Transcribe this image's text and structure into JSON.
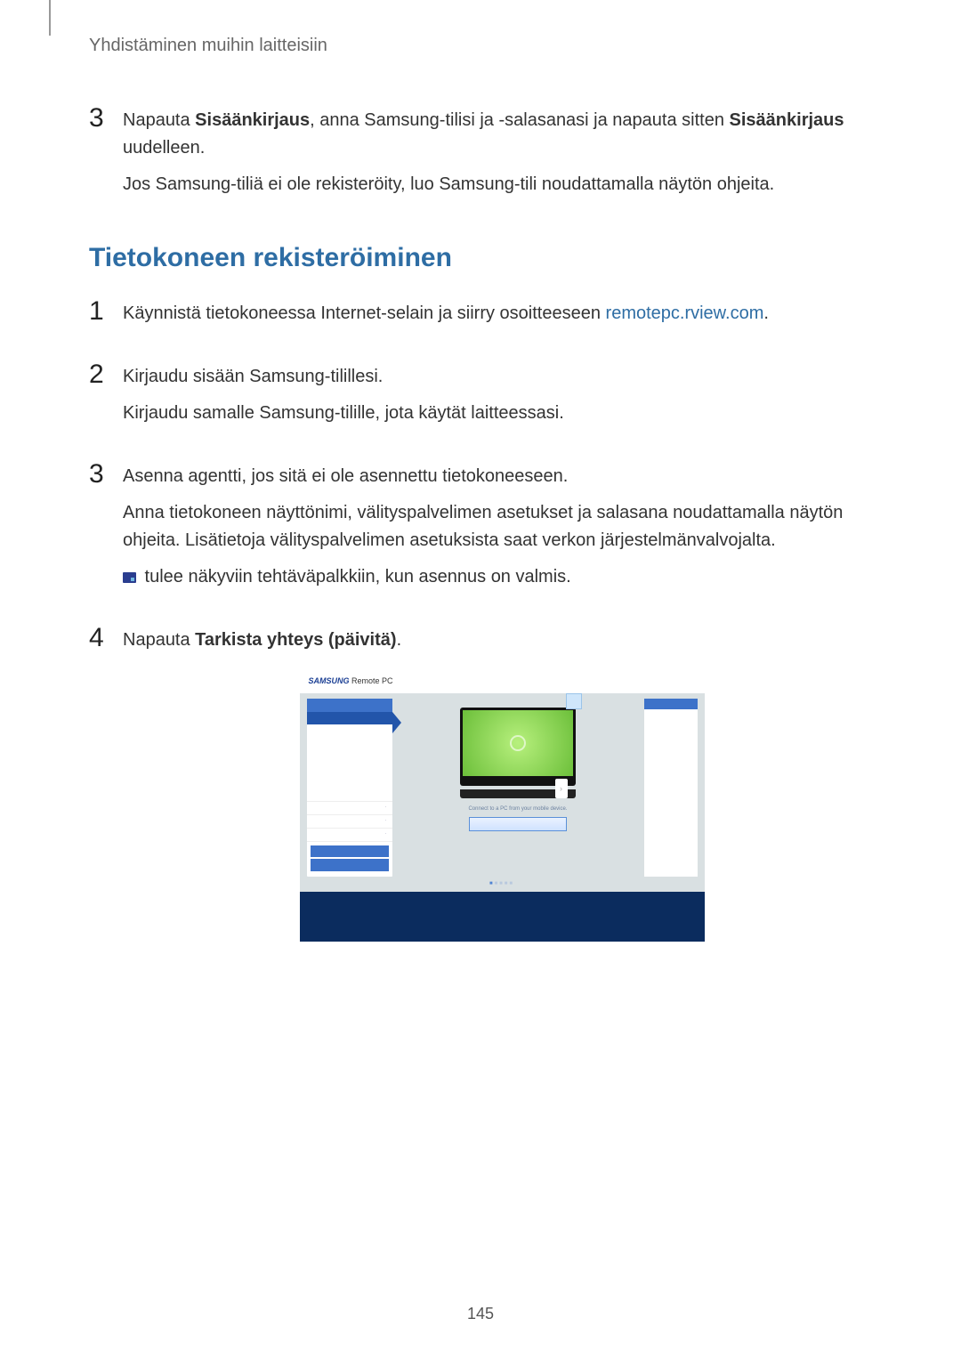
{
  "header": {
    "running_head": "Yhdistäminen muihin laitteisiin"
  },
  "intro_step": {
    "number": "3",
    "text_pre": "Napauta ",
    "bold1": "Sisäänkirjaus",
    "text_mid": ", anna Samsung-tilisi ja -salasanasi ja napauta sitten ",
    "bold2": "Sisäänkirjaus",
    "text_post": " uudelleen.",
    "para2": "Jos Samsung-tiliä ei ole rekisteröity, luo Samsung-tili noudattamalla näytön ohjeita."
  },
  "section_heading": "Tietokoneen rekisteröiminen",
  "steps": {
    "s1": {
      "number": "1",
      "text_pre": "Käynnistä tietokoneessa Internet-selain ja siirry osoitteeseen ",
      "link": "remotepc.rview.com",
      "text_post": "."
    },
    "s2": {
      "number": "2",
      "p1": "Kirjaudu sisään Samsung-tilillesi.",
      "p2": "Kirjaudu samalle Samsung-tilille, jota käytät laitteessasi."
    },
    "s3": {
      "number": "3",
      "p1": "Asenna agentti, jos sitä ei ole asennettu tietokoneeseen.",
      "p2": "Anna tietokoneen näyttönimi, välityspalvelimen asetukset ja salasana noudattamalla näytön ohjeita. Lisätietoja välityspalvelimen asetuksista saat verkon järjestelmänvalvojalta.",
      "p3": " tulee näkyviin tehtäväpalkkiin, kun asennus on valmis."
    },
    "s4": {
      "number": "4",
      "text_pre": "Napauta ",
      "bold": "Tarkista yhteys (päivitä)",
      "text_post": "."
    }
  },
  "screenshot": {
    "brand": "SAMSUNG",
    "brand_sub": "Remote PC",
    "caption": "Connect to a PC from your mobile device.",
    "nav_right": "›"
  },
  "page_number": "145"
}
